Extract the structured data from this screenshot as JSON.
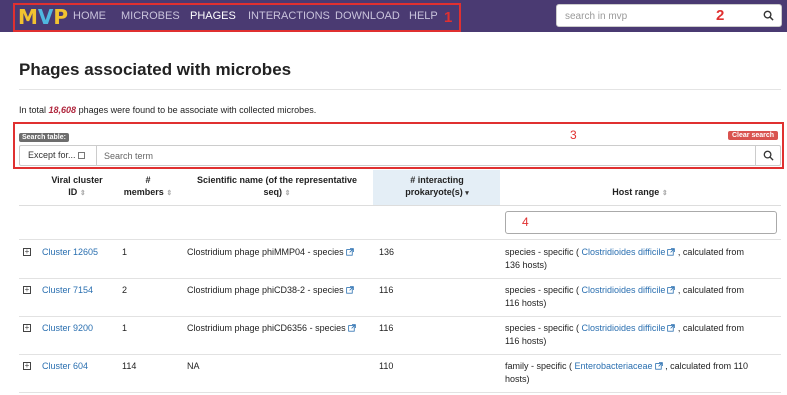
{
  "navbar": {
    "brand": {
      "m": "M",
      "v": "V",
      "p": "P"
    },
    "items": [
      {
        "label": "HOME"
      },
      {
        "label": "MICROBES"
      },
      {
        "label": "PHAGES",
        "active": true
      },
      {
        "label": "INTERACTIONS"
      },
      {
        "label": "DOWNLOAD"
      },
      {
        "label": "HELP"
      }
    ],
    "search_placeholder": "search in mvp",
    "annotation": "1"
  },
  "annotations": {
    "n2": "2",
    "n3": "3",
    "n4": "4"
  },
  "page": {
    "title": "Phages associated with microbes",
    "summary_prefix": "In total ",
    "summary_count": "18,608",
    "summary_suffix": " phages were found to be associate with collected microbes."
  },
  "table_search": {
    "tag": "Search table:",
    "clear": "Clear search",
    "except_label": "Except for...",
    "placeholder": "Search term"
  },
  "table": {
    "headers": {
      "viral_cluster": "Viral cluster ID",
      "viral_cluster_l1": "Viral cluster",
      "viral_cluster_l2": "ID",
      "members_l1": "#",
      "members_l2": "members",
      "sci_l1": "Scientific name (of the representative",
      "sci_l2": "seq)",
      "interacting_l1": "# interacting",
      "interacting_l2": "prokaryote(s)",
      "host_range": "Host range"
    },
    "rows": [
      {
        "cluster": "Cluster 12605",
        "members": "1",
        "name": "Clostridium phage phiMMP04 - species",
        "interacting": "136",
        "host_pre": "species - specific ( ",
        "host_link": "Clostridioides difficile",
        "host_post": " , calculated from",
        "host_line2": "136 hosts)"
      },
      {
        "cluster": "Cluster 7154",
        "members": "2",
        "name": "Clostridium phage phiCD38-2 - species",
        "interacting": "116",
        "host_pre": "species - specific ( ",
        "host_link": "Clostridioides difficile",
        "host_post": " , calculated from",
        "host_line2": "116 hosts)"
      },
      {
        "cluster": "Cluster 9200",
        "members": "1",
        "name": "Clostridium phage phiCD6356 - species",
        "interacting": "116",
        "host_pre": "species - specific ( ",
        "host_link": "Clostridioides difficile",
        "host_post": " , calculated from",
        "host_line2": "116 hosts)"
      },
      {
        "cluster": "Cluster 604",
        "members": "114",
        "name": "NA",
        "interacting": "110",
        "host_pre": "family - specific ( ",
        "host_link": "Enterobacteriaceae",
        "host_post": " , calculated from 110",
        "host_line2": "hosts)"
      }
    ]
  },
  "colors": {
    "navbar": "#4a3a72",
    "annotation_red": "#e03030",
    "link": "#2a6fb0",
    "count": "#b0263d"
  }
}
